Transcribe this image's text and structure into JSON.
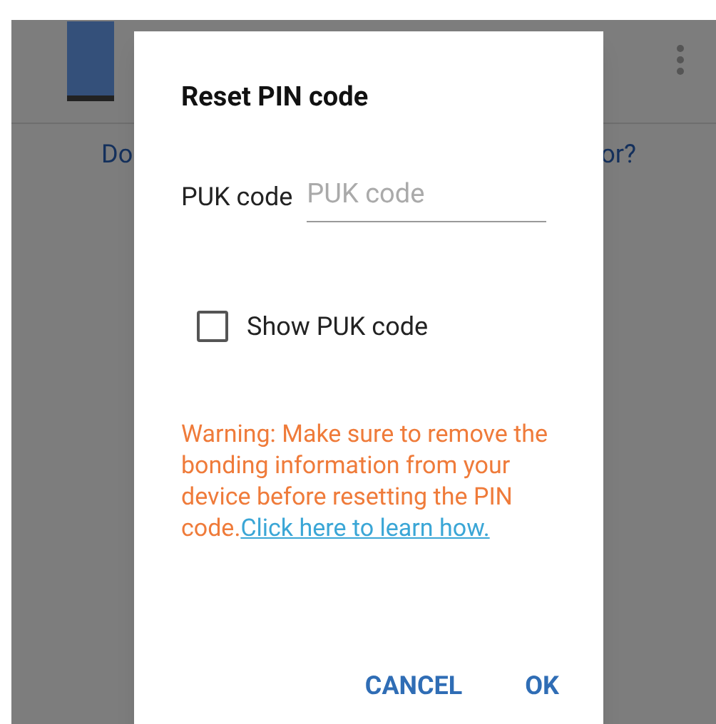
{
  "background": {
    "left_text": "Do",
    "right_text": "or?"
  },
  "dialog": {
    "title": "Reset PIN code",
    "field": {
      "label": "PUK code",
      "placeholder": "PUK code"
    },
    "checkbox": {
      "label": "Show PUK code",
      "checked": false
    },
    "warning": "Warning: Make sure to remove the bonding information from your device before resetting the PIN code.",
    "link": "Click here to learn how.",
    "buttons": [
      "CANCEL",
      "OK"
    ]
  }
}
